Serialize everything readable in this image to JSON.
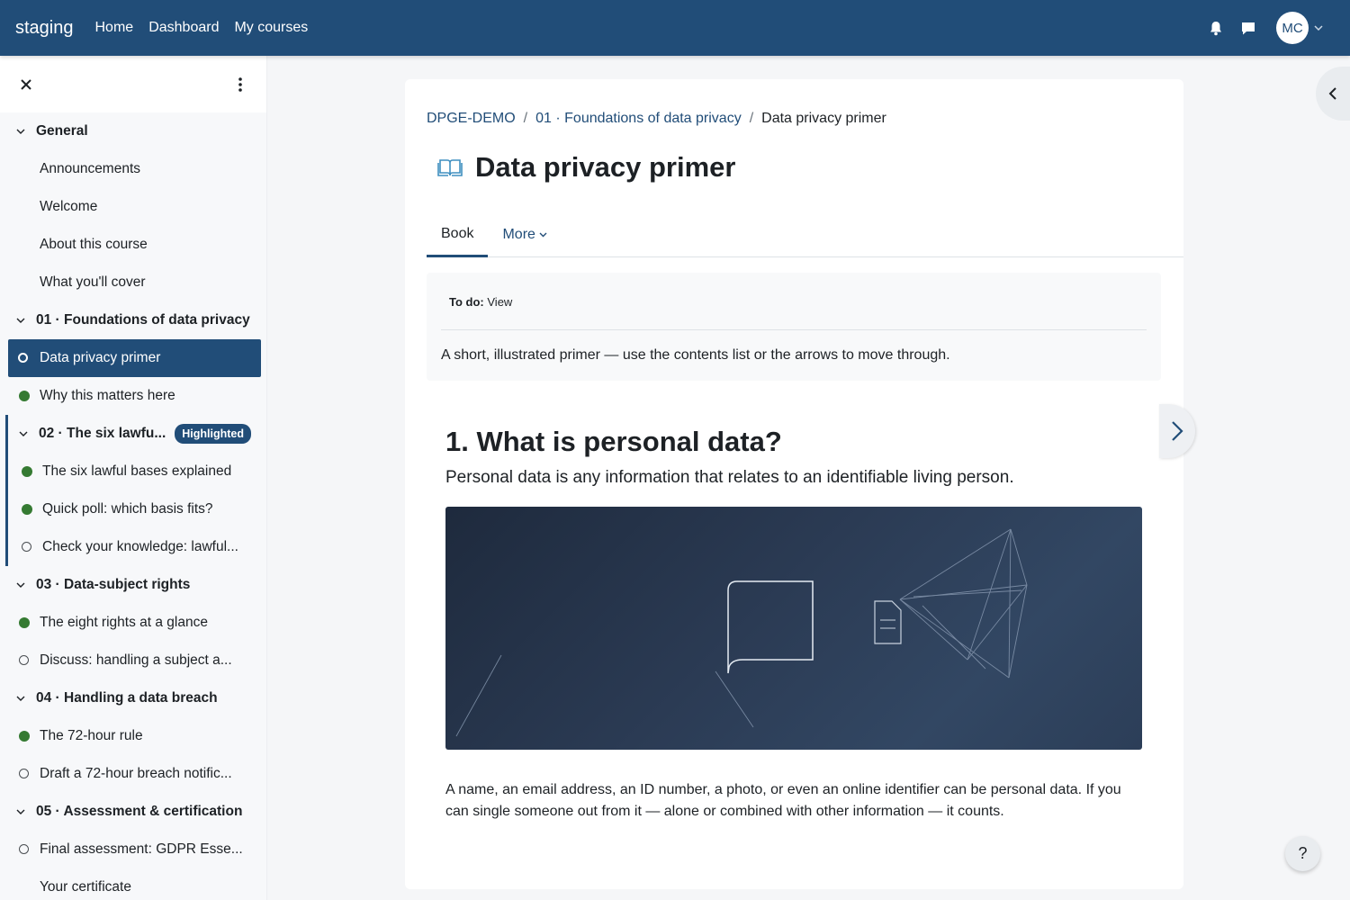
{
  "navbar": {
    "brand": "staging",
    "links": [
      "Home",
      "Dashboard",
      "My courses"
    ],
    "avatar_initials": "MC",
    "icons": [
      "bell-icon",
      "chat-icon",
      "chevron-down-icon"
    ],
    "background": "#214d78"
  },
  "drawer": {
    "sections": [
      {
        "title": "General",
        "items": [
          {
            "label": "Announcements",
            "status": "none"
          },
          {
            "label": "Welcome",
            "status": "none"
          },
          {
            "label": "About this course",
            "status": "none"
          },
          {
            "label": "What you'll cover",
            "status": "none"
          }
        ]
      },
      {
        "title": "01 · Foundations of data privacy",
        "items": [
          {
            "label": "Data privacy primer",
            "status": "todo",
            "active": true
          },
          {
            "label": "Why this matters here",
            "status": "done"
          }
        ]
      },
      {
        "title": "02 · The six lawfu...",
        "badge": "Highlighted",
        "items": [
          {
            "label": "The six lawful bases explained",
            "status": "done"
          },
          {
            "label": "Quick poll: which basis fits?",
            "status": "done"
          },
          {
            "label": "Check your knowledge: lawful...",
            "status": "todo"
          }
        ]
      },
      {
        "title": "03 · Data-subject rights",
        "items": [
          {
            "label": "The eight rights at a glance",
            "status": "done"
          },
          {
            "label": "Discuss: handling a subject a...",
            "status": "todo"
          }
        ]
      },
      {
        "title": "04 · Handling a data breach",
        "items": [
          {
            "label": "The 72-hour rule",
            "status": "done"
          },
          {
            "label": "Draft a 72-hour breach notific...",
            "status": "todo"
          }
        ]
      },
      {
        "title": "05 · Assessment & certification",
        "items": [
          {
            "label": "Final assessment: GDPR Esse...",
            "status": "todo"
          },
          {
            "label": "Your certificate",
            "status": "none"
          }
        ]
      }
    ]
  },
  "breadcrumb": {
    "items": [
      "DPGE-DEMO",
      "01 · Foundations of data privacy"
    ],
    "current": "Data privacy primer"
  },
  "page": {
    "title": "Data privacy primer",
    "tabs": {
      "book": "Book",
      "more": "More"
    }
  },
  "activity": {
    "todo_label": "To do:",
    "todo_value": "View",
    "intro": "A short, illustrated primer — use the contents list or the arrows to move through."
  },
  "chapter": {
    "title": "1. What is personal data?",
    "lead": "Personal data is any information that relates to an identifiable living person.",
    "body": "A name, an email address, an ID number, a photo, or even an online identifier can be personal data. If you can single someone out from it — alone or combined with other information — it counts."
  },
  "help": {
    "label": "?"
  }
}
